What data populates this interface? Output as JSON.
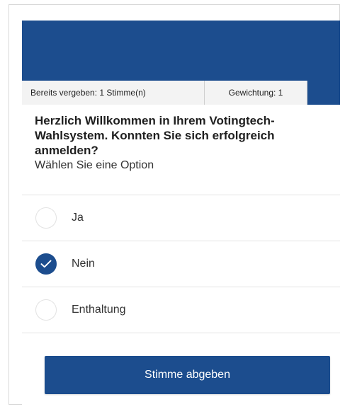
{
  "info_bar": {
    "votes_cast": "Bereits vergeben: 1 Stimme(n)",
    "weighting": "Gewichtung: 1"
  },
  "question": {
    "text": "Herzlich Willkommen in Ihrem Votingtech-Wahlsystem. Konnten Sie sich erfolgreich anmelden?",
    "hint": "Wählen Sie eine Option"
  },
  "options": [
    {
      "label": "Ja",
      "selected": false
    },
    {
      "label": "Nein",
      "selected": true
    },
    {
      "label": "Enthaltung",
      "selected": false
    }
  ],
  "submit_label": "Stimme abgeben",
  "colors": {
    "primary": "#1c4d8e",
    "tab_background": "#f3f3f3",
    "divider": "#e3e3e3"
  },
  "icons": {
    "selected_option": "check-icon"
  }
}
